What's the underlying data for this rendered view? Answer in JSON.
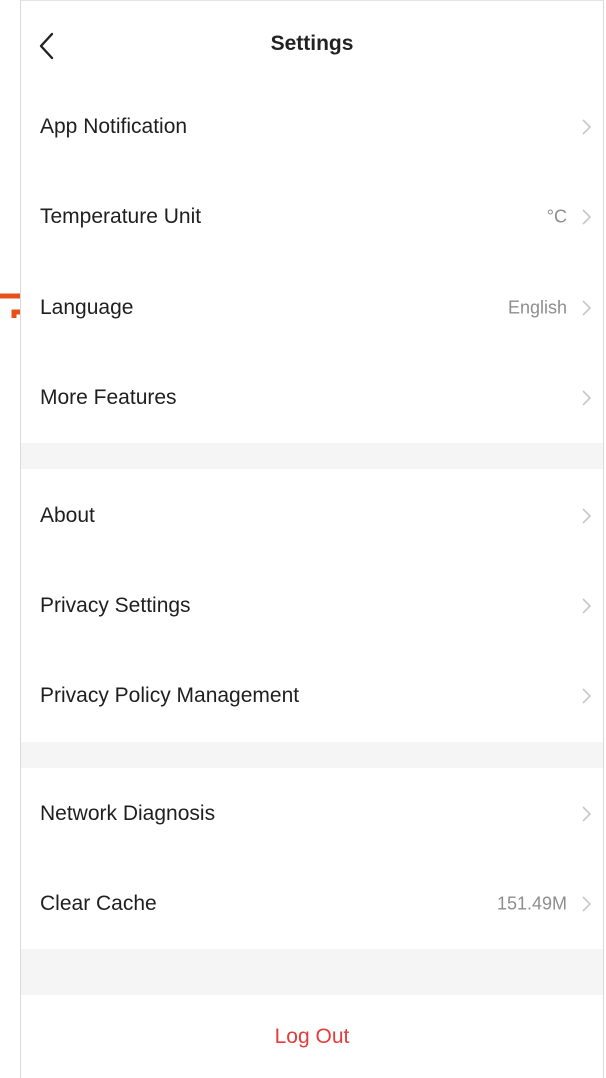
{
  "header": {
    "title": "Settings"
  },
  "groups": [
    {
      "items": [
        {
          "label": "App Notification",
          "value": ""
        },
        {
          "label": "Temperature Unit",
          "value": "°C"
        },
        {
          "label": "Language",
          "value": "English"
        },
        {
          "label": "More Features",
          "value": ""
        }
      ]
    },
    {
      "items": [
        {
          "label": "About",
          "value": ""
        },
        {
          "label": "Privacy Settings",
          "value": ""
        },
        {
          "label": "Privacy Policy Management",
          "value": ""
        }
      ]
    },
    {
      "items": [
        {
          "label": "Network Diagnosis",
          "value": ""
        },
        {
          "label": "Clear Cache",
          "value": "151.49M"
        }
      ]
    }
  ],
  "logout": {
    "label": "Log Out"
  },
  "colors": {
    "logout": "#e23c3c",
    "marker": "#e8501a",
    "chevron": "#c7c7c7"
  },
  "icons": {
    "back": "chevron-left-icon",
    "row": "chevron-right-icon"
  }
}
